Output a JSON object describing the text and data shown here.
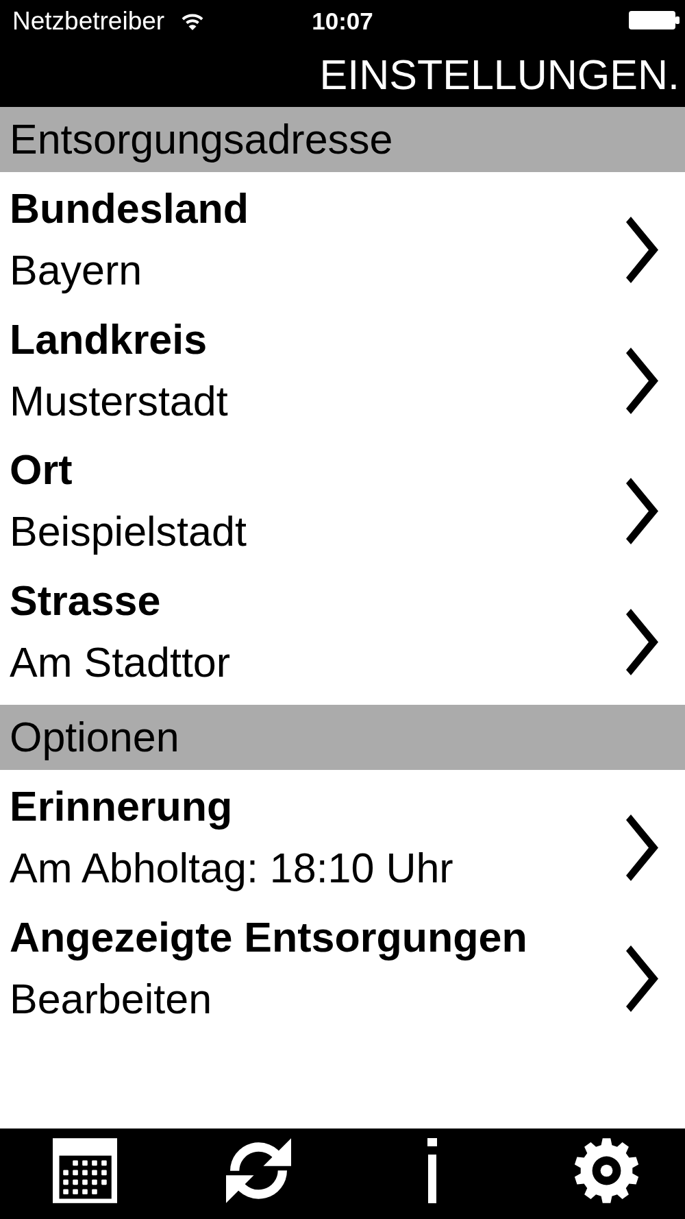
{
  "status_bar": {
    "carrier": "Netzbetreiber",
    "time": "10:07"
  },
  "navigation_bar": {
    "title": "EINSTELLUNGEN."
  },
  "sections": [
    {
      "title": "Entsorgungsadresse",
      "rows": [
        {
          "label": "Bundesland",
          "value": "Bayern"
        },
        {
          "label": "Landkreis",
          "value": "Musterstadt"
        },
        {
          "label": "Ort",
          "value": "Beispielstadt"
        },
        {
          "label": "Strasse",
          "value": "Am Stadttor"
        }
      ]
    },
    {
      "title": "Optionen",
      "rows": [
        {
          "label": "Erinnerung",
          "value": "Am Abholtag: 18:10 Uhr"
        },
        {
          "label": "Angezeigte Entsorgungen",
          "value": "Bearbeiten"
        }
      ]
    }
  ]
}
